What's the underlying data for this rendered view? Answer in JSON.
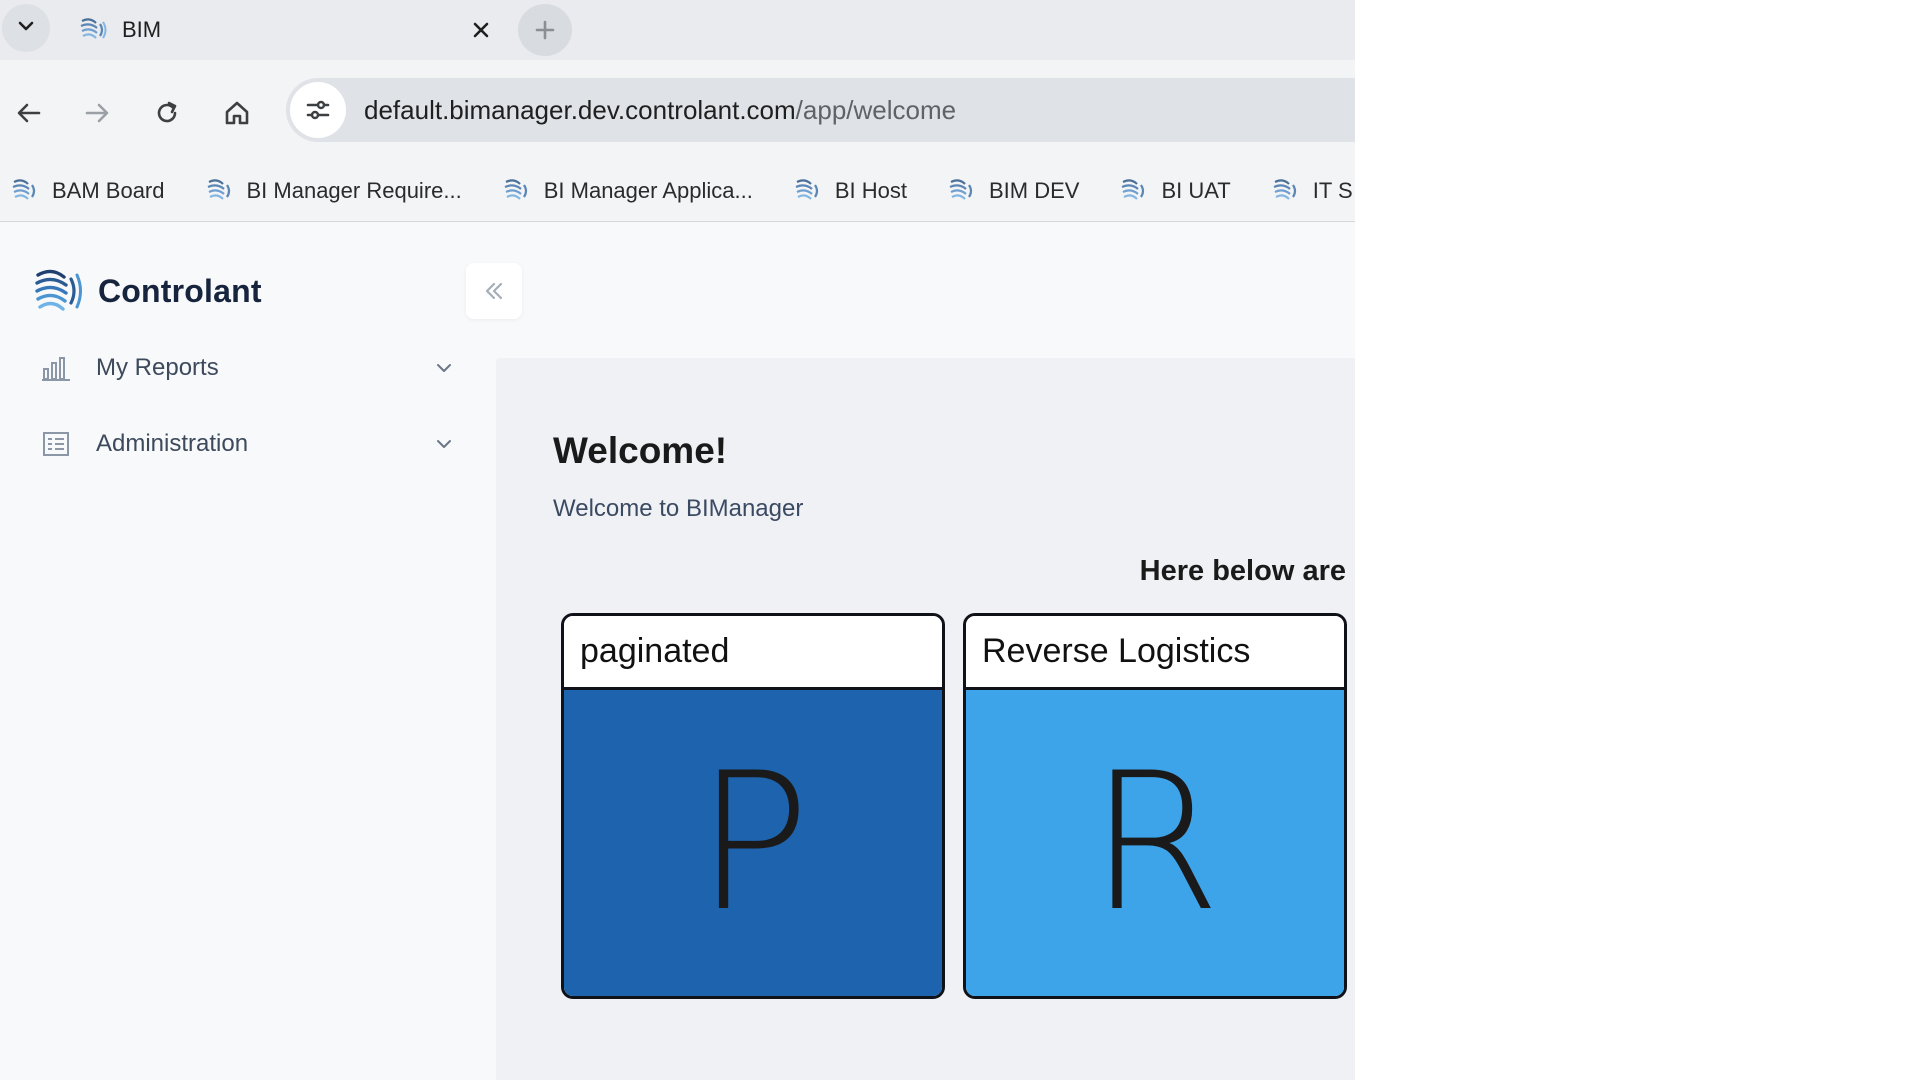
{
  "colors": {
    "card_paginated_bg": "#1d63ad",
    "card_reverse_bg": "#3ea4ea",
    "logo_blue": "#2f6fb3"
  },
  "browser": {
    "tab_title": "BIM",
    "url_host": "default.bimanager.dev.controlant.com",
    "url_path": "/app/welcome",
    "bookmarks": [
      {
        "label": "BAM Board"
      },
      {
        "label": "BI Manager Require..."
      },
      {
        "label": "BI Manager Applica..."
      },
      {
        "label": "BI Host"
      },
      {
        "label": "BIM DEV"
      },
      {
        "label": "BI UAT"
      },
      {
        "label": "IT S"
      }
    ]
  },
  "app": {
    "brand": "Controlant",
    "sidebar": {
      "items": [
        {
          "label": "My Reports",
          "icon": "bar-chart-icon"
        },
        {
          "label": "Administration",
          "icon": "admin-list-icon"
        }
      ]
    },
    "main": {
      "title": "Welcome!",
      "subtitle": "Welcome to BIManager",
      "section_heading": "Here below are",
      "cards": [
        {
          "title": "paginated",
          "letter": "P"
        },
        {
          "title": "Reverse Logistics",
          "letter": "R"
        }
      ]
    }
  }
}
